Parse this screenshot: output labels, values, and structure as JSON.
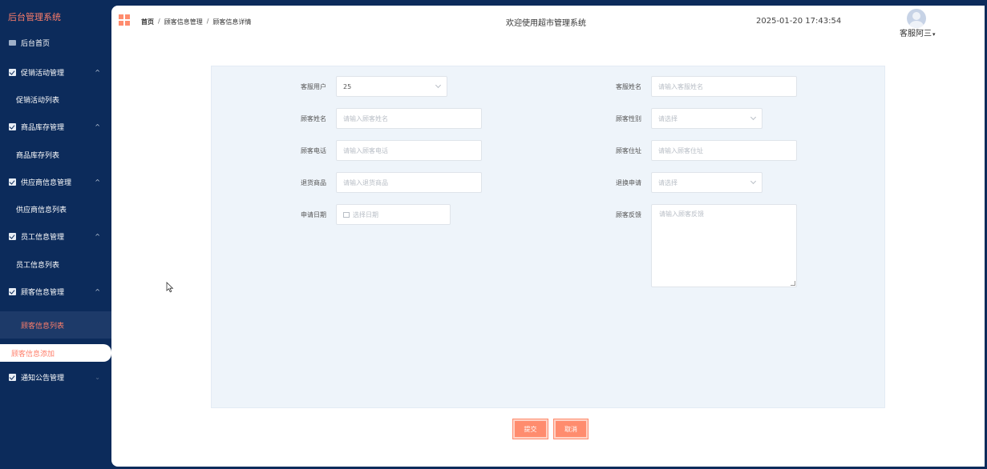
{
  "sidebar": {
    "brand": "后台管理系统",
    "home": "后台首页",
    "groups": [
      {
        "label": "促销活动管理",
        "sub": "促销活动列表"
      },
      {
        "label": "商品库存管理",
        "sub": "商品库存列表"
      },
      {
        "label": "供应商信息管理",
        "sub": "供应商信息列表"
      },
      {
        "label": "员工信息管理",
        "sub": "员工信息列表"
      },
      {
        "label": "顾客信息管理",
        "sub": "顾客信息列表",
        "sub2": "顾客信息添加"
      },
      {
        "label": "通知公告管理"
      }
    ],
    "caret_up": "^",
    "caret_down": "⌄"
  },
  "header": {
    "breadcrumb": [
      "首页",
      "顾客信息管理",
      "顾客信息详情"
    ],
    "separator": "/",
    "welcome": "欢迎使用超市管理系统",
    "datetime": "2025-01-20 17:43:54",
    "user": "客服阿三",
    "user_caret": "▾"
  },
  "form": {
    "service_user": {
      "label": "客服用户",
      "value": "25"
    },
    "service_name": {
      "label": "客服姓名",
      "placeholder": "请输入客服姓名"
    },
    "customer_name": {
      "label": "顾客姓名",
      "placeholder": "请输入顾客姓名"
    },
    "customer_gender": {
      "label": "顾客性别",
      "placeholder": "请选择"
    },
    "customer_phone": {
      "label": "顾客电话",
      "placeholder": "请输入顾客电话"
    },
    "customer_address": {
      "label": "顾客住址",
      "placeholder": "请输入顾客住址"
    },
    "return_goods": {
      "label": "退货商品",
      "placeholder": "请输入退货商品"
    },
    "exchange_request": {
      "label": "退换申请",
      "placeholder": "请选择"
    },
    "apply_date": {
      "label": "申请日期",
      "placeholder": "选择日期"
    },
    "feedback": {
      "label": "顾客反馈",
      "placeholder": "请输入顾客反馈"
    }
  },
  "actions": {
    "submit": "提交",
    "cancel": "取消"
  },
  "colors": {
    "sidebar": "#0c2b5b",
    "accent": "#ff8c6e",
    "panel": "#eef4fa"
  }
}
